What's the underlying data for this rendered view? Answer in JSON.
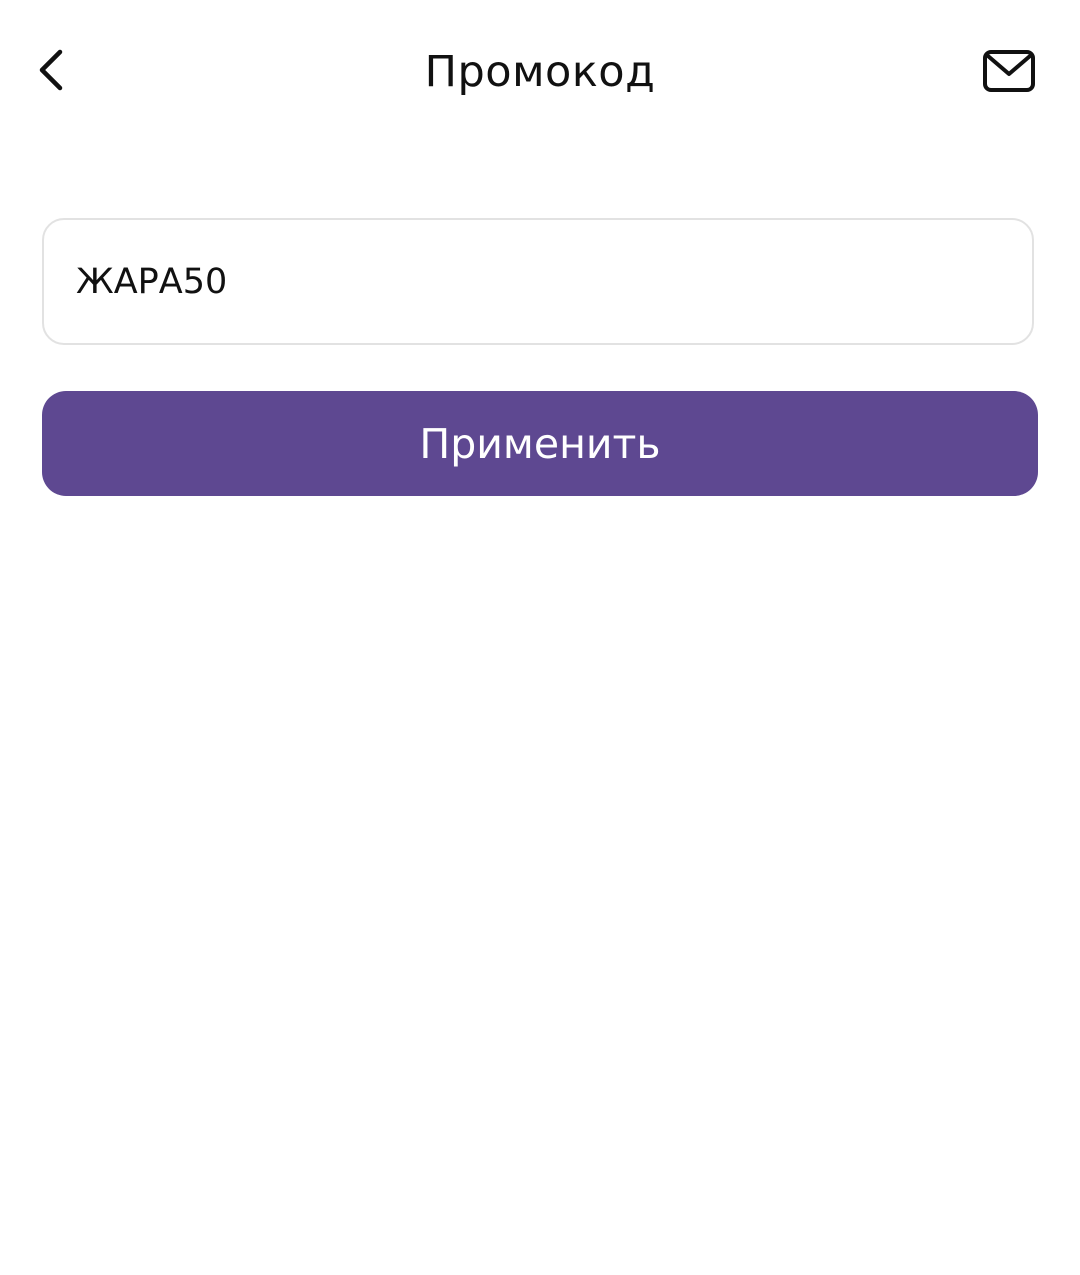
{
  "header": {
    "title": "Промокод",
    "back_icon": "chevron-left-icon",
    "mail_icon": "envelope-icon"
  },
  "promo": {
    "value": "ЖАРА50",
    "apply_label": "Применить"
  },
  "colors": {
    "accent": "#5e4891",
    "field_border": "#e2e2e2",
    "text": "#111111",
    "background": "#ffffff"
  }
}
